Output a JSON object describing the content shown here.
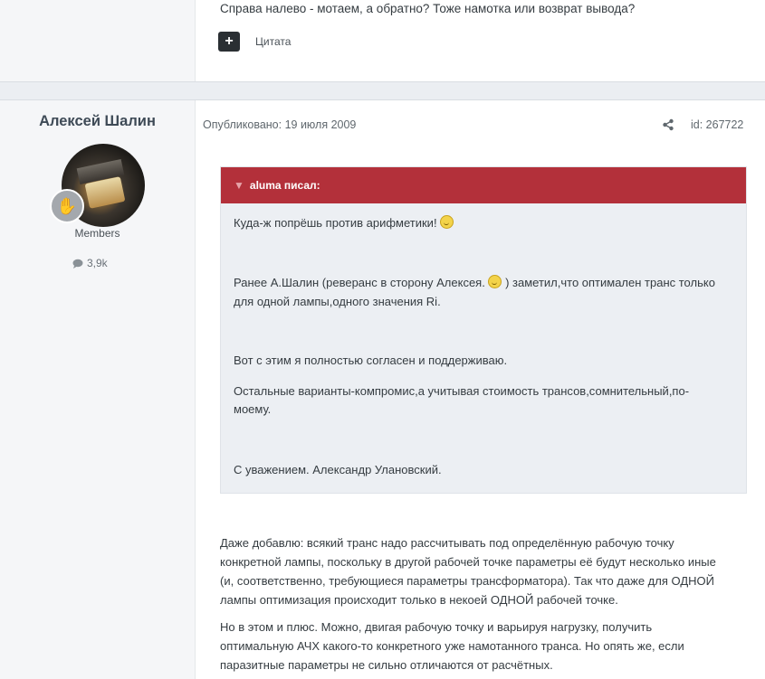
{
  "prev_post": {
    "text": "Справа налево - мотаем, а обратно? Тоже намотка или возврат вывода?",
    "quote_button_icon": "plus-icon",
    "quote_label": "Цитата"
  },
  "author": {
    "name": "Алексей Шалин",
    "group": "Members",
    "post_count": "3,9k",
    "count_icon": "comment-icon",
    "rank_icon": "hand-icon"
  },
  "meta": {
    "published": "Опубликовано: 19 июля 2009",
    "share_icon": "share-icon",
    "post_id": "id: 267722"
  },
  "quote": {
    "header": "aluma писал:",
    "header_color": "#b3303a",
    "lines": [
      "Куда-ж попрёшь против арифметики!",
      "Ранее А.Шалин (реверанс в сторону Алексея.",
      ") заметил,что оптимален транс только",
      "для одной лампы,одного значения Ri.",
      "Вот с этим я полностью согласен и поддерживаю.",
      "Остальные варианты-компромис,а учитывая стоимость трансов,сомнительный,по-",
      "моему.",
      "С уважением. Александр Улановский."
    ]
  },
  "body": {
    "p1": [
      "Даже добавлю: всякий транс надо рассчитывать под определённую рабочую точку",
      "конкретной лампы, поскольку в другой рабочей точке параметры её будут несколько иные",
      "(и, соответственно, требующиеся параметры трансформатора). Так что даже для ОДНОЙ",
      "лампы оптимизация происходит только в некоей ОДНОЙ рабочей точке."
    ],
    "p2": [
      "Но в этом и плюс. Можно, двигая рабочую точку и варьируя нагрузку, получить",
      "оптимальную АЧХ какого-то конкретного уже намотанного транса. Но опять же, если",
      "паразитные параметры не сильно отличаются от расчётных."
    ]
  }
}
